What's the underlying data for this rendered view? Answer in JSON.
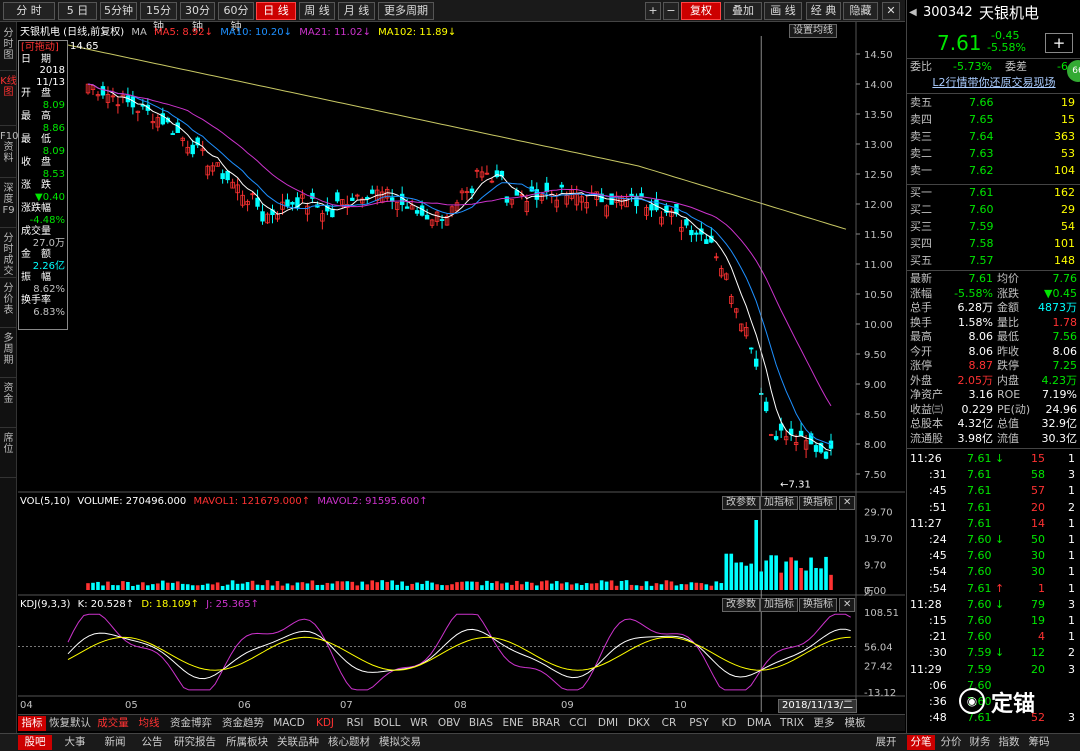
{
  "toolbar": {
    "periods": [
      "分 时",
      "5 日",
      "5分钟",
      "15分钟",
      "30分钟",
      "60分钟",
      "日 线",
      "周 线",
      "月 线",
      "更多周期"
    ],
    "right_buttons": [
      "+",
      "−",
      "复权",
      "叠加",
      "画 线",
      "经 典",
      "隐藏"
    ],
    "close_icon": "close-icon"
  },
  "leftrail": [
    "分时图",
    "K线图",
    "F10资料",
    "深度F9",
    "分时成交",
    "分价表",
    "多周期",
    "资金",
    "席位"
  ],
  "chart_header": {
    "name": "天银机电 (日线,前复权)",
    "ma_label": "MA",
    "ma5": "MA5: 8.92",
    "ma10": "MA10: 10.20",
    "ma21": "MA21: 11.02",
    "ma102": "MA102: 11.89",
    "settings": "设置均线"
  },
  "info_box": {
    "title": "[可拖动]",
    "date_label": "日　期",
    "date_year": "2018",
    "date_md": "11/13",
    "open_label": "开　盘",
    "open": "8.09",
    "high_label": "最　高",
    "high": "8.86",
    "low_label": "最　低",
    "low": "8.09",
    "close_label": "收　盘",
    "close": "8.53",
    "chg_label": "涨　跌",
    "chg": "▼0.40",
    "pct_label": "涨跌幅",
    "pct": "-4.48%",
    "vol_label": "成交量",
    "vol": "27.0万",
    "amt_label": "金　额",
    "amt": "2.26亿",
    "amp_label": "振　幅",
    "amp": "8.62%",
    "turn_label": "换手率",
    "turn": "6.83%"
  },
  "price_axis": [
    "14.50",
    "14.00",
    "13.50",
    "13.00",
    "12.50",
    "12.00",
    "11.50",
    "11.00",
    "10.50",
    "10.00",
    "9.50",
    "9.00",
    "8.50",
    "8.00",
    "7.50"
  ],
  "price_annotations": {
    "high_mark": "14.65",
    "low_mark": "7.31"
  },
  "vol_header": {
    "label": "VOL(5,10)",
    "volume": "VOLUME: 270496.000",
    "mavol1": "MAVOL1: 121679.000",
    "mavol2": "MAVOL2: 91595.600",
    "btn_params": "改参数",
    "btn_add": "加指标",
    "btn_switch": "换指标"
  },
  "vol_axis": [
    "29.70",
    "19.70",
    "9.70",
    "0.00"
  ],
  "vol_unit": "万",
  "kdj_header": {
    "label": "KDJ(9,3,3)",
    "k": "K: 20.528",
    "d": "D: 18.109",
    "j": "J: 25.365"
  },
  "kdj_axis": [
    "108.51",
    "56.04",
    "27.42",
    "-13.12"
  ],
  "x_axis": [
    "04",
    "05",
    "06",
    "07",
    "08",
    "09",
    "10"
  ],
  "cursor_date": "2018/11/13/二",
  "indicator_tabs": [
    "指标",
    "恢复默认",
    "成交量",
    "均线",
    "资金博弈",
    "资金趋势",
    "MACD",
    "KDJ",
    "RSI",
    "BOLL",
    "WR",
    "OBV",
    "BIAS",
    "ENE",
    "BRAR",
    "CCI",
    "DMI",
    "DKX",
    "CR",
    "PSY",
    "KD",
    "DMA",
    "TRIX",
    "更多",
    "模板"
  ],
  "bottom_tabs": [
    "股吧",
    "大事",
    "新闻",
    "公告",
    "研究报告",
    "所属板块",
    "关联品种",
    "核心题材",
    "模拟交易"
  ],
  "bottom_right": [
    "展开",
    "分笔",
    "分价",
    "财务",
    "指数",
    "筹码"
  ],
  "right": {
    "code": "300342",
    "name": "天银机电",
    "price": "7.61",
    "change": "-0.45",
    "change_pct": "-5.58%",
    "weibi_label": "委比",
    "weibi": "-5.73%",
    "weicha_label": "委差",
    "weicha": "-6",
    "badge": "66",
    "l2_link": "L2行情带你还原交易现场",
    "asks": [
      {
        "label": "卖五",
        "price": "7.66",
        "vol": "19"
      },
      {
        "label": "卖四",
        "price": "7.65",
        "vol": "15"
      },
      {
        "label": "卖三",
        "price": "7.64",
        "vol": "363"
      },
      {
        "label": "卖二",
        "price": "7.63",
        "vol": "53"
      },
      {
        "label": "卖一",
        "price": "7.62",
        "vol": "104"
      }
    ],
    "bids": [
      {
        "label": "买一",
        "price": "7.61",
        "vol": "162"
      },
      {
        "label": "买二",
        "price": "7.60",
        "vol": "29"
      },
      {
        "label": "买三",
        "price": "7.59",
        "vol": "54"
      },
      {
        "label": "买四",
        "price": "7.58",
        "vol": "101"
      },
      {
        "label": "买五",
        "price": "7.57",
        "vol": "148"
      }
    ],
    "stats": [
      {
        "l1": "最新",
        "v1": "7.61",
        "c1": "green",
        "l2": "均价",
        "v2": "7.76",
        "c2": "green"
      },
      {
        "l1": "涨幅",
        "v1": "-5.58%",
        "c1": "green",
        "l2": "涨跌",
        "v2": "▼0.45",
        "c2": "green"
      },
      {
        "l1": "总手",
        "v1": "6.28万",
        "c1": "white",
        "l2": "金额",
        "v2": "4873万",
        "c2": "cyan"
      },
      {
        "l1": "换手",
        "v1": "1.58%",
        "c1": "white",
        "l2": "量比",
        "v2": "1.78",
        "c2": "red"
      },
      {
        "l1": "最高",
        "v1": "8.06",
        "c1": "white",
        "l2": "最低",
        "v2": "7.56",
        "c2": "green"
      },
      {
        "l1": "今开",
        "v1": "8.06",
        "c1": "white",
        "l2": "昨收",
        "v2": "8.06",
        "c2": "white"
      },
      {
        "l1": "涨停",
        "v1": "8.87",
        "c1": "red",
        "l2": "跌停",
        "v2": "7.25",
        "c2": "green"
      },
      {
        "l1": "外盘",
        "v1": "2.05万",
        "c1": "red",
        "l2": "内盘",
        "v2": "4.23万",
        "c2": "green"
      },
      {
        "l1": "净资产",
        "v1": "3.16",
        "c1": "white",
        "l2": "ROE",
        "v2": "7.19%",
        "c2": "white"
      },
      {
        "l1": "收益㈢",
        "v1": "0.229",
        "c1": "white",
        "l2": "PE(动)",
        "v2": "24.96",
        "c2": "white"
      },
      {
        "l1": "总股本",
        "v1": "4.32亿",
        "c1": "white",
        "l2": "总值",
        "v2": "32.9亿",
        "c2": "white"
      },
      {
        "l1": "流通股",
        "v1": "3.98亿",
        "c1": "white",
        "l2": "流值",
        "v2": "30.3亿",
        "c2": "white"
      }
    ],
    "ticks": [
      {
        "t": "11:26",
        "p": "7.61",
        "pc": "green",
        "arrow": "↓",
        "ac": "green",
        "v": "15",
        "vc": "red",
        "n": "1"
      },
      {
        "t": ":31",
        "p": "7.61",
        "pc": "green",
        "arrow": "",
        "ac": "",
        "v": "58",
        "vc": "green",
        "n": "3"
      },
      {
        "t": ":45",
        "p": "7.61",
        "pc": "green",
        "arrow": "",
        "ac": "",
        "v": "57",
        "vc": "red",
        "n": "1"
      },
      {
        "t": ":51",
        "p": "7.61",
        "pc": "green",
        "arrow": "",
        "ac": "",
        "v": "20",
        "vc": "red",
        "n": "2"
      },
      {
        "t": "11:27",
        "p": "7.61",
        "pc": "green",
        "arrow": "",
        "ac": "",
        "v": "14",
        "vc": "red",
        "n": "1"
      },
      {
        "t": ":24",
        "p": "7.60",
        "pc": "green",
        "arrow": "↓",
        "ac": "green",
        "v": "50",
        "vc": "green",
        "n": "1"
      },
      {
        "t": ":45",
        "p": "7.60",
        "pc": "green",
        "arrow": "",
        "ac": "",
        "v": "30",
        "vc": "green",
        "n": "1"
      },
      {
        "t": ":54",
        "p": "7.60",
        "pc": "green",
        "arrow": "",
        "ac": "",
        "v": "30",
        "vc": "green",
        "n": "1"
      },
      {
        "t": ":54",
        "p": "7.61",
        "pc": "green",
        "arrow": "↑",
        "ac": "red",
        "v": "1",
        "vc": "red",
        "n": "1"
      },
      {
        "t": "11:28",
        "p": "7.60",
        "pc": "green",
        "arrow": "↓",
        "ac": "green",
        "v": "79",
        "vc": "green",
        "n": "3"
      },
      {
        "t": ":15",
        "p": "7.60",
        "pc": "green",
        "arrow": "",
        "ac": "",
        "v": "19",
        "vc": "green",
        "n": "1"
      },
      {
        "t": ":21",
        "p": "7.60",
        "pc": "green",
        "arrow": "",
        "ac": "",
        "v": "4",
        "vc": "red",
        "n": "1"
      },
      {
        "t": ":30",
        "p": "7.59",
        "pc": "green",
        "arrow": "↓",
        "ac": "green",
        "v": "12",
        "vc": "green",
        "n": "2"
      },
      {
        "t": "11:29",
        "p": "7.59",
        "pc": "green",
        "arrow": "",
        "ac": "",
        "v": "20",
        "vc": "green",
        "n": "3"
      },
      {
        "t": ":06",
        "p": "7.60",
        "pc": "green",
        "arrow": "",
        "ac": "",
        "v": "",
        "vc": "green",
        "n": ""
      },
      {
        "t": ":36",
        "p": "7.60",
        "pc": "green",
        "arrow": "",
        "ac": "",
        "v": "",
        "vc": "green",
        "n": ""
      },
      {
        "t": ":48",
        "p": "7.61",
        "pc": "green",
        "arrow": "",
        "ac": "",
        "v": "52",
        "vc": "red",
        "n": "3"
      }
    ],
    "watermark": "定锚"
  },
  "colors": {
    "up": "#ff3232",
    "down": "#00ffff",
    "ma5": "#ffffff",
    "ma10": "#1e90ff",
    "ma21": "#cc33cc",
    "ma102": "#c8c864",
    "k": "#ffffff",
    "d": "#ffff00",
    "j": "#cc33cc"
  }
}
